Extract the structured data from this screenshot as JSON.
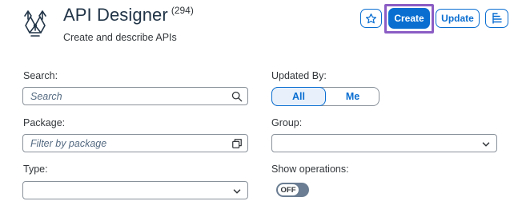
{
  "header": {
    "app_icon": "pen-nib-arrows-icon",
    "title": "API Designer",
    "count": "(294)",
    "subtitle": "Create and describe APIs"
  },
  "toolbar": {
    "favorite_icon": "star-icon",
    "create_label": "Create",
    "update_label": "Update",
    "settings_icon": "list-settings-icon"
  },
  "filters": {
    "search": {
      "label": "Search:",
      "placeholder": "Search",
      "icon": "search-icon"
    },
    "updated_by": {
      "label": "Updated By:",
      "options": [
        "All",
        "Me"
      ],
      "selected": "All"
    },
    "package": {
      "label": "Package:",
      "placeholder": "Filter by package",
      "icon": "value-help-icon"
    },
    "group": {
      "label": "Group:",
      "value": "",
      "icon": "chevron-down-icon"
    },
    "type": {
      "label": "Type:",
      "value": "",
      "icon": "chevron-down-icon"
    },
    "show_operations": {
      "label": "Show operations:",
      "state": "OFF"
    }
  },
  "colors": {
    "accent": "#0a6ed1",
    "focus_outline": "#8b5cc4",
    "toggle_off": "#6a7d92"
  }
}
